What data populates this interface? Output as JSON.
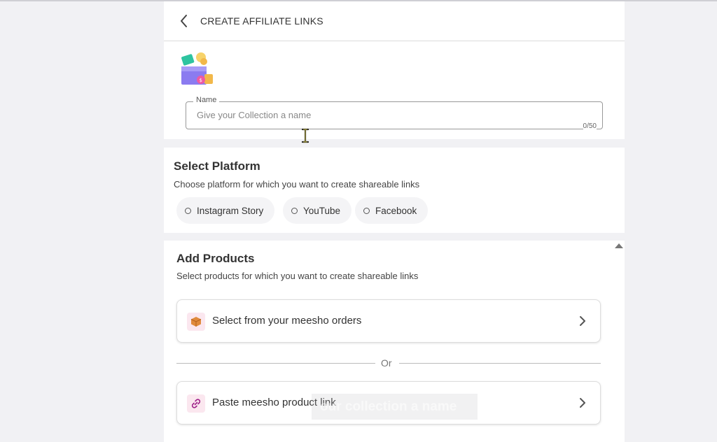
{
  "header": {
    "title": "CREATE AFFILIATE LINKS"
  },
  "name_field": {
    "label": "Name",
    "placeholder": "Give your Collection a name",
    "value": "",
    "counter": "0/50"
  },
  "platform": {
    "title": "Select Platform",
    "subtitle": "Choose platform for which you want to create shareable links",
    "options": [
      {
        "label": "Instagram Story",
        "selected": false
      },
      {
        "label": "YouTube",
        "selected": false
      },
      {
        "label": "Facebook",
        "selected": false
      }
    ]
  },
  "products": {
    "title": "Add Products",
    "subtitle": "Select products for which you want to create shareable links",
    "option1": {
      "label": "Select from your meesho orders",
      "icon": "package-icon"
    },
    "divider": "Or",
    "option2": {
      "label": "Paste meesho product link",
      "icon": "link-icon"
    }
  },
  "toast": {
    "text": "our collection a name"
  },
  "colors": {
    "accent": "#9f2089",
    "chip_bg": "#f4f4f6",
    "icon_bg": "#fbe7ef",
    "page_bg": "#f1f1f4"
  }
}
